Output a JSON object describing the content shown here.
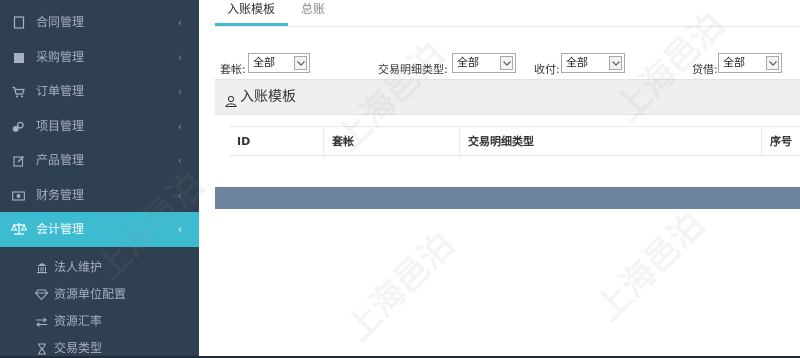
{
  "sidebar": {
    "menu": [
      {
        "label": "合同管理",
        "icon": "document-icon",
        "arrow": "‹"
      },
      {
        "label": "采购管理",
        "icon": "square-icon",
        "arrow": "‹"
      },
      {
        "label": "订单管理",
        "icon": "cart-icon",
        "arrow": "‹"
      },
      {
        "label": "项目管理",
        "icon": "project-icon",
        "arrow": "‹"
      },
      {
        "label": "产品管理",
        "icon": "edit-icon",
        "arrow": "‹"
      },
      {
        "label": "财务管理",
        "icon": "money-icon",
        "arrow": "‹"
      },
      {
        "label": "会计管理",
        "icon": "balance-scale-icon",
        "arrow": "‹"
      }
    ],
    "submenu": [
      {
        "label": "法人维护",
        "icon": "bank-icon"
      },
      {
        "label": "资源单位配置",
        "icon": "diamond-icon"
      },
      {
        "label": "资源汇率",
        "icon": "exchange-icon"
      },
      {
        "label": "交易类型",
        "icon": "hourglass-icon"
      }
    ]
  },
  "tabs": [
    {
      "label": "入账模板"
    },
    {
      "label": "总账"
    }
  ],
  "filters": [
    {
      "label": "套帐:",
      "value": "全部"
    },
    {
      "label": "交易明细类型:",
      "value": "全部"
    },
    {
      "label": "收付:",
      "value": "全部"
    },
    {
      "label": "贷借:",
      "value": "全部"
    }
  ],
  "panel": {
    "title": "入账模板",
    "icon": "user-icon"
  },
  "table": {
    "columns": [
      "ID",
      "套帐",
      "交易明细类型",
      "序号"
    ]
  },
  "watermark": "上海邑泊",
  "colors": {
    "sidebar_bg": "#2f4050",
    "active": "#3dbbd1",
    "grid_footer": "#6c849e"
  }
}
